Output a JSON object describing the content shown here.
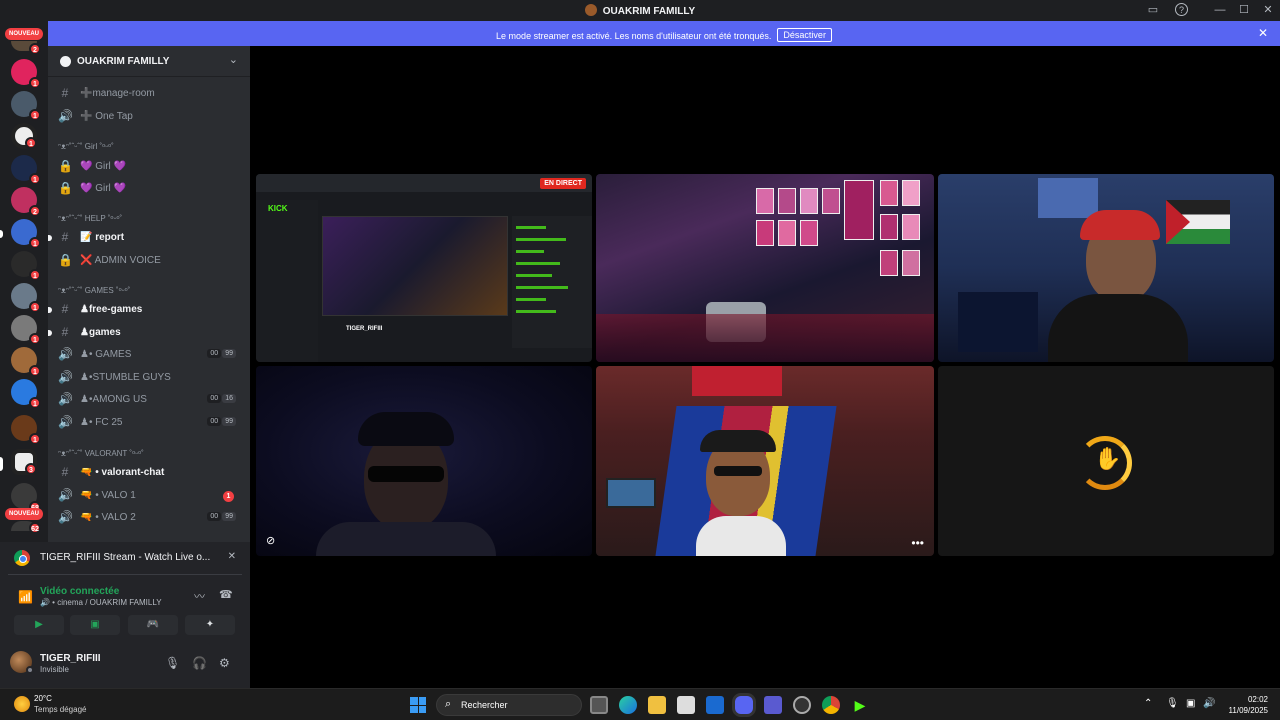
{
  "window": {
    "title": "OUAKRIM FAMILLY",
    "controls": {
      "inbox": "▭",
      "help": "?",
      "minimize": "—",
      "maximize": "☐",
      "close": "✕"
    }
  },
  "banner": {
    "message": "Le mode streamer est activé. Les noms d'utilisateur ont été tronqués.",
    "button": "Désactiver",
    "close": "✕"
  },
  "guilds": {
    "nouveau_top": "NOUVEAU",
    "nouveau_bottom": "NOUVEAU",
    "badges": [
      "2",
      "1",
      "1",
      "1",
      "1",
      "2",
      "1",
      "1",
      "1",
      "1",
      "1",
      "1",
      "1",
      "3",
      "68",
      "62"
    ]
  },
  "server": {
    "name": "OUAKRIM FAMILLY",
    "categories": [
      "ᵔᴥᵔ˚ˆᵕˆ˚ Girl ˚ᵒᵕᵒ˚",
      "ᵔᴥᵔ˚ˆᵕˆ˚ HELP ˚ᵒᵕᵒ˚",
      "ᵔᴥᵔ˚ˆᵕˆ˚ GAMES ˚ᵒᵕᵒ˚",
      "ᵔᴥᵔ˚ˆᵕˆ˚ VALORANT ˚ᵒᵕᵒ˚"
    ],
    "channels": [
      {
        "label": "➕manage-room"
      },
      {
        "label": "➕ One Tap"
      },
      {
        "label": "💜 Girl 💜"
      },
      {
        "label": "💜 Girl 💜"
      },
      {
        "label": "📝 report"
      },
      {
        "label": "❌ ADMIN VOICE"
      },
      {
        "label": "♟free-games"
      },
      {
        "label": "♟games"
      },
      {
        "label": "♟• GAMES",
        "p1": "00",
        "p2": "99"
      },
      {
        "label": "♟•STUMBLE GUYS"
      },
      {
        "label": "♟•AMONG US",
        "p1": "00",
        "p2": "16"
      },
      {
        "label": "♟• FC 25",
        "p1": "00",
        "p2": "99"
      },
      {
        "label": "🔫 • valorant-chat"
      },
      {
        "label": "🔫 • VALO 1",
        "badge": "1"
      },
      {
        "label": "🔫 • VALO 2",
        "p1": "00",
        "p2": "99"
      }
    ]
  },
  "stream_panel": {
    "title": "TIGER_RIFIII Stream - Watch Live o...",
    "voice_status": "Vidéo connectée",
    "voice_channel": "🔊 • cinema / OUAKRIM FAMILLY"
  },
  "user": {
    "name": "TIGER_RIFIII",
    "status": "Invisible"
  },
  "stage": {
    "live_badge": "EN DIRECT",
    "kick_logo": "KICK",
    "kick_streamer": "TIGER_RIFIII"
  },
  "taskbar": {
    "temperature": "20°C",
    "weather": "Temps dégagé",
    "search": "Rechercher",
    "time": "02:02",
    "date": "11/09/2025"
  },
  "colors": {
    "accent": "#5865f2",
    "online": "#23a55a",
    "mention": "#f23f42",
    "sidebar": "#2b2d31",
    "guildbar": "#1e1f22"
  }
}
